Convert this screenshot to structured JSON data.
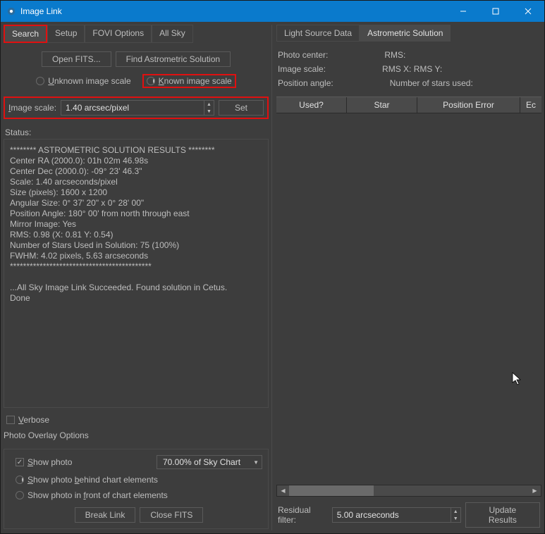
{
  "window": {
    "title": "Image Link"
  },
  "left": {
    "tabs": [
      "Search",
      "Setup",
      "FOVI Options",
      "All Sky"
    ],
    "buttons": {
      "openFits": "Open FITS...",
      "findSolution": "Find Astrometric Solution"
    },
    "scaleMode": {
      "unknown": "Unknown image scale",
      "known": "Known image scale"
    },
    "imageScale": {
      "label": "Image scale:",
      "value": "1.40 arcsec/pixel",
      "setBtn": "Set"
    },
    "status": {
      "label": "Status:",
      "text": "******** ASTROMETRIC SOLUTION RESULTS ********\nCenter RA (2000.0): 01h 02m 46.98s\nCenter Dec (2000.0): -09° 23' 46.3\"\nScale: 1.40 arcseconds/pixel\nSize (pixels): 1600 x 1200\nAngular Size: 0° 37' 20\" x 0° 28' 00\"\nPosition Angle: 180° 00' from north through east\nMirror Image: Yes\nRMS: 0.98 (X: 0.81 Y: 0.54)\nNumber of Stars Used in Solution: 75 (100%)\nFWHM: 4.02 pixels, 5.63 arcseconds\n*******************************************\n\n...All Sky Image Link Succeeded. Found solution in Cetus.\nDone"
    },
    "verbose": "Verbose",
    "overlay": {
      "title": "Photo Overlay Options",
      "showPhoto": "Show photo",
      "coverage": "70.00% of Sky Chart",
      "behind": "Show photo behind chart elements",
      "front": "Show photo in front of chart elements",
      "breakLink": "Break Link",
      "closeFits": "Close FITS"
    }
  },
  "right": {
    "tabs": [
      "Light Source Data",
      "Astrometric Solution"
    ],
    "labels": {
      "photoCenter": "Photo center:",
      "rms": "RMS:",
      "imageScale": "Image scale:",
      "rmsXY": "RMS X:  RMS Y:",
      "positionAngle": "Position angle:",
      "numStars": "Number of stars used:"
    },
    "cols": {
      "used": "Used?",
      "star": "Star",
      "posErr": "Position Error",
      "ext": "Ec"
    },
    "filter": {
      "label": "Residual filter:",
      "value": "5.00 arcseconds",
      "update": "Update Results"
    }
  }
}
